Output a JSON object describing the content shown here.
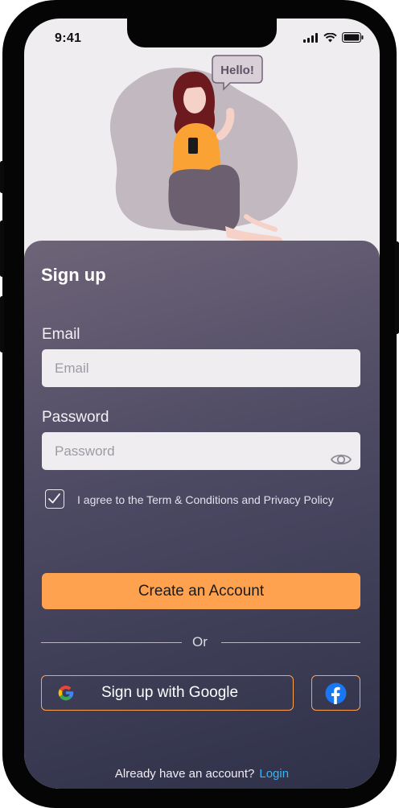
{
  "status_bar": {
    "time": "9:41"
  },
  "illustration": {
    "speech_bubble": "Hello!"
  },
  "form": {
    "title": "Sign up",
    "email_label": "Email",
    "email_placeholder": "Email",
    "password_label": "Password",
    "password_placeholder": "Password",
    "agree_text": "I agree to the Term & Conditions and Privacy Policy",
    "agree_checked": true,
    "create_button": "Create an Account",
    "divider_text": "Or",
    "google_button": "Sign up with Google",
    "footer_text": "Already have an account?",
    "login_link": "Login"
  },
  "colors": {
    "accent": "#ffa24f",
    "link": "#39b4f2",
    "panel_top": "#6e6478",
    "panel_bottom": "#2f3149",
    "facebook": "#1877f2"
  },
  "icons": [
    "signal-icon",
    "wifi-icon",
    "battery-icon",
    "eye-icon",
    "checkmark-icon",
    "google-icon",
    "facebook-icon"
  ]
}
